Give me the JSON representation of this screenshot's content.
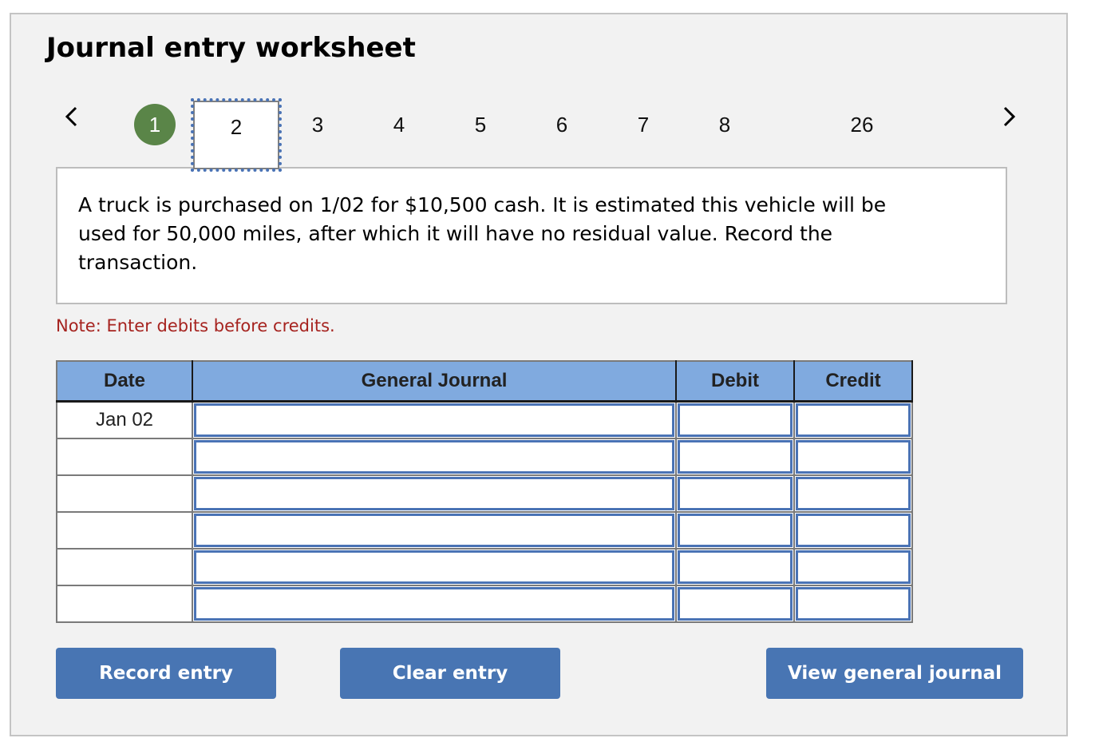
{
  "title": "Journal entry worksheet",
  "nav": {
    "prev_icon": "chevron-left-icon",
    "next_icon": "chevron-right-icon",
    "tabs": [
      {
        "label": "1",
        "state": "completed"
      },
      {
        "label": "2",
        "state": "active"
      },
      {
        "label": "3",
        "state": "default"
      },
      {
        "label": "4",
        "state": "default"
      },
      {
        "label": "5",
        "state": "default"
      },
      {
        "label": "6",
        "state": "default"
      },
      {
        "label": "7",
        "state": "default"
      },
      {
        "label": "8",
        "state": "default"
      },
      {
        "label": "26",
        "state": "default"
      }
    ]
  },
  "question": "A truck is purchased on 1/02 for $10,500 cash. It is estimated this vehicle will be used for 50,000 miles, after which it will have no residual value. Record the transaction.",
  "note": "Note: Enter debits before credits.",
  "journal": {
    "headers": {
      "date": "Date",
      "general_journal": "General Journal",
      "debit": "Debit",
      "credit": "Credit"
    },
    "rows": [
      {
        "date": "Jan 02",
        "account": "",
        "debit": "",
        "credit": ""
      },
      {
        "date": "",
        "account": "",
        "debit": "",
        "credit": ""
      },
      {
        "date": "",
        "account": "",
        "debit": "",
        "credit": ""
      },
      {
        "date": "",
        "account": "",
        "debit": "",
        "credit": ""
      },
      {
        "date": "",
        "account": "",
        "debit": "",
        "credit": ""
      },
      {
        "date": "",
        "account": "",
        "debit": "",
        "credit": ""
      }
    ]
  },
  "buttons": {
    "record": "Record entry",
    "clear": "Clear entry",
    "view": "View general journal"
  },
  "colors": {
    "accent_blue": "#4875b3",
    "header_blue": "#80aadf",
    "completed_green": "#5a8548",
    "note_red": "#a6231f"
  }
}
